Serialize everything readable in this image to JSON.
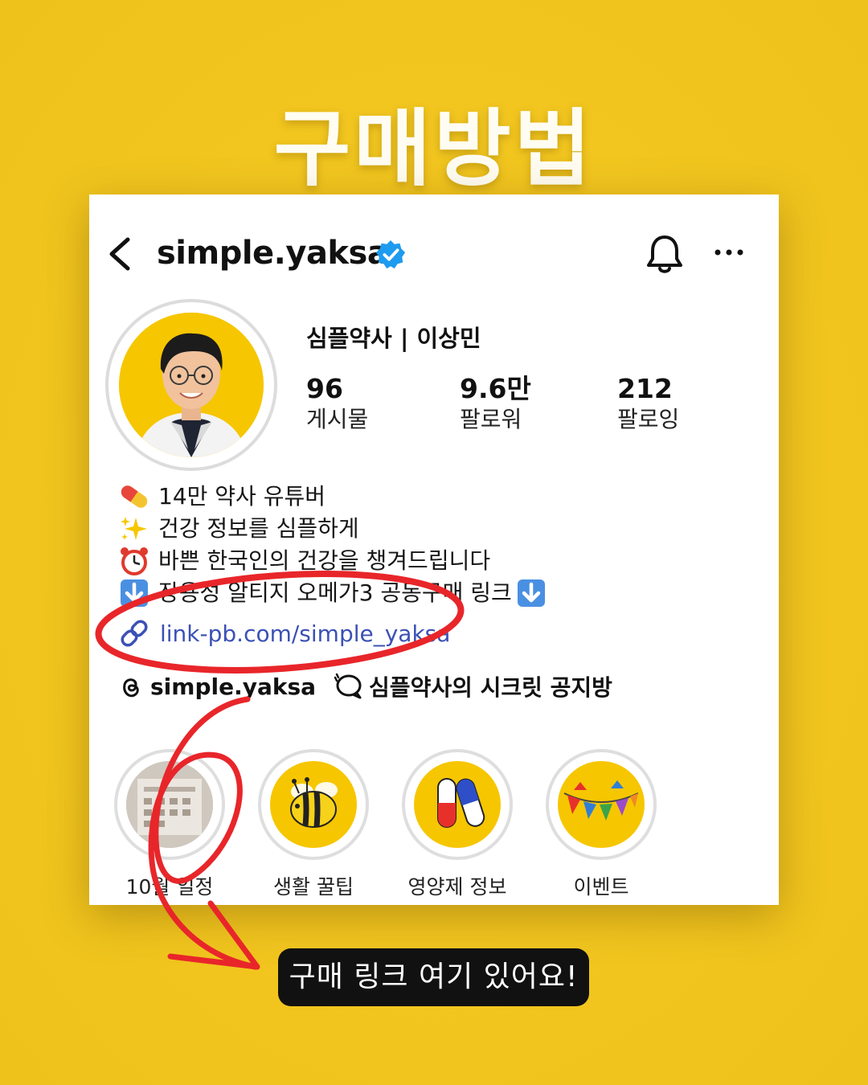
{
  "headline": "구매방법",
  "profile": {
    "username": "simple.yaksa",
    "display_name": "심플약사 | 이상민",
    "stats": [
      {
        "value": "96",
        "label": "게시물"
      },
      {
        "value": "9.6만",
        "label": "팔로워"
      },
      {
        "value": "212",
        "label": "팔로잉"
      }
    ],
    "bio": [
      {
        "icon": "pill-icon",
        "text": "14만 약사 유튜버"
      },
      {
        "icon": "sparkles-icon",
        "text": "건강 정보를 심플하게"
      },
      {
        "icon": "alarm-clock-icon",
        "text": "바쁜 한국인의 건강을 챙겨드립니다"
      },
      {
        "icon": "down-arrow-icon",
        "text": "장용성 알티지 오메가3 공동구매 링크"
      }
    ],
    "link": "link-pb.com/simple_yaksa",
    "threads_handle": "simple.yaksa",
    "channel_name": "심플약사의 시크릿 공지방"
  },
  "highlights": [
    {
      "label": "10월 일정",
      "icon": "schedule-photo"
    },
    {
      "label": "생활 꿀팁",
      "icon": "bee-icon"
    },
    {
      "label": "영양제 정보",
      "icon": "capsules-icon"
    },
    {
      "label": "이벤트",
      "icon": "bunting-flags-icon"
    }
  ],
  "callout": "구매 링크 여기 있어요!",
  "colors": {
    "background": "#f2c61f",
    "accent_yellow": "#f6c600",
    "link": "#3b51b5",
    "verified": "#1d9bf0",
    "annotation_red": "#e8262a"
  }
}
